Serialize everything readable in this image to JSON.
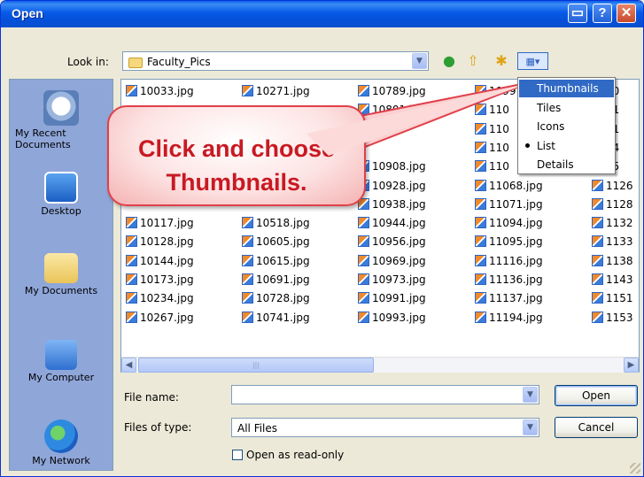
{
  "window": {
    "title": "Open",
    "buttons": [
      "minimize",
      "help",
      "close"
    ]
  },
  "toolbar": {
    "look_in_label": "Look in:",
    "look_in_value": "Faculty_Pics",
    "icons": [
      "back-icon",
      "up-folder-icon",
      "new-folder-icon",
      "view-menu-icon"
    ]
  },
  "places": [
    {
      "label": "My Recent Documents",
      "icon": "recent-documents-icon"
    },
    {
      "label": "Desktop",
      "icon": "desktop-icon"
    },
    {
      "label": "My Documents",
      "icon": "my-documents-icon"
    },
    {
      "label": "My Computer",
      "icon": "my-computer-icon"
    },
    {
      "label": "My Network",
      "icon": "my-network-icon"
    }
  ],
  "files": {
    "col1": [
      "10033.jpg",
      "",
      "",
      "",
      "",
      "",
      "",
      "10117.jpg",
      "10128.jpg",
      "10144.jpg",
      "10173.jpg",
      "10234.jpg",
      "10267.jpg"
    ],
    "col2": [
      "10271.jpg",
      "",
      "",
      "",
      "",
      "",
      "",
      "10518.jpg",
      "10605.jpg",
      "10615.jpg",
      "10691.jpg",
      "10728.jpg",
      "10741.jpg"
    ],
    "col3": [
      "10789.jpg",
      "10801.jpg",
      "",
      "",
      "10908.jpg",
      "10928.jpg",
      "10938.jpg",
      "10944.jpg",
      "10956.jpg",
      "10969.jpg",
      "10973.jpg",
      "10991.jpg",
      "10993.jpg"
    ],
    "col4": [
      "1099",
      "110",
      "110",
      "110",
      "110",
      "11068.jpg",
      "11071.jpg",
      "11094.jpg",
      "11095.jpg",
      "11116.jpg",
      "11136.jpg",
      "11137.jpg",
      "11194.jpg"
    ],
    "col5": [
      "20",
      "21",
      "21",
      "24",
      "25",
      "1126",
      "1128",
      "1132",
      "1133",
      "1138",
      "1143",
      "1151",
      "1153"
    ]
  },
  "view_menu": {
    "items": [
      "Thumbnails",
      "Tiles",
      "Icons",
      "List",
      "Details"
    ],
    "highlighted": "Thumbnails",
    "selected": "List"
  },
  "callout": {
    "line1": "Click and choose",
    "line2": "Thumbnails."
  },
  "form": {
    "file_name_label": "File name:",
    "file_name_value": "",
    "files_of_type_label": "Files of type:",
    "files_of_type_value": "All Files",
    "readonly_label": "Open as read-only",
    "open_button": "Open",
    "cancel_button": "Cancel"
  },
  "colors": {
    "titlebar": "#0759e6",
    "highlight": "#316ac5",
    "callout_text": "#c81922"
  }
}
